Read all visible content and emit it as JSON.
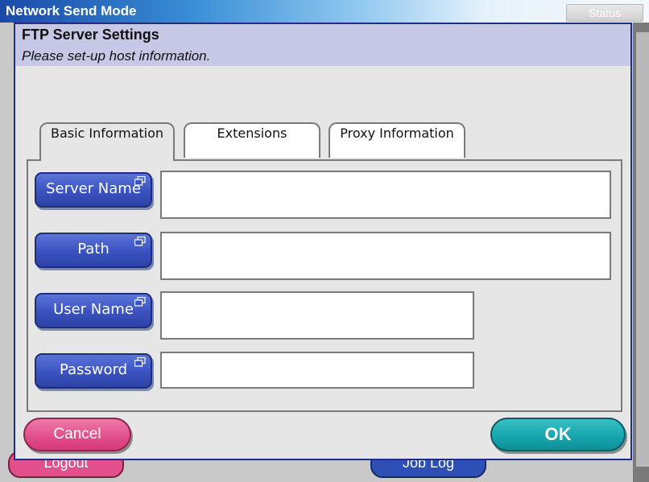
{
  "window": {
    "title": "Network Send Mode",
    "status_label": "Status"
  },
  "background_buttons": {
    "logout_label": "Logout",
    "joblog_label": "Job Log"
  },
  "dialog": {
    "title": "FTP Server Settings",
    "subtitle": "Please set-up host information."
  },
  "tabs": [
    {
      "label": "Basic Information",
      "active": true
    },
    {
      "label": "Extensions",
      "active": false
    },
    {
      "label": "Proxy Information",
      "active": false
    }
  ],
  "fields": {
    "server_name": {
      "label": "Server Name",
      "value": ""
    },
    "path": {
      "label": "Path",
      "value": ""
    },
    "user_name": {
      "label": "User Name",
      "value": ""
    },
    "password": {
      "label": "Password",
      "value": ""
    }
  },
  "actions": {
    "cancel_label": "Cancel",
    "ok_label": "OK"
  },
  "colors": {
    "titlebar": "#1a4aa8",
    "field_button": "#3a52c0",
    "cancel": "#e04d88",
    "ok": "#16a4ad",
    "dialog_border": "#1e2f88"
  }
}
